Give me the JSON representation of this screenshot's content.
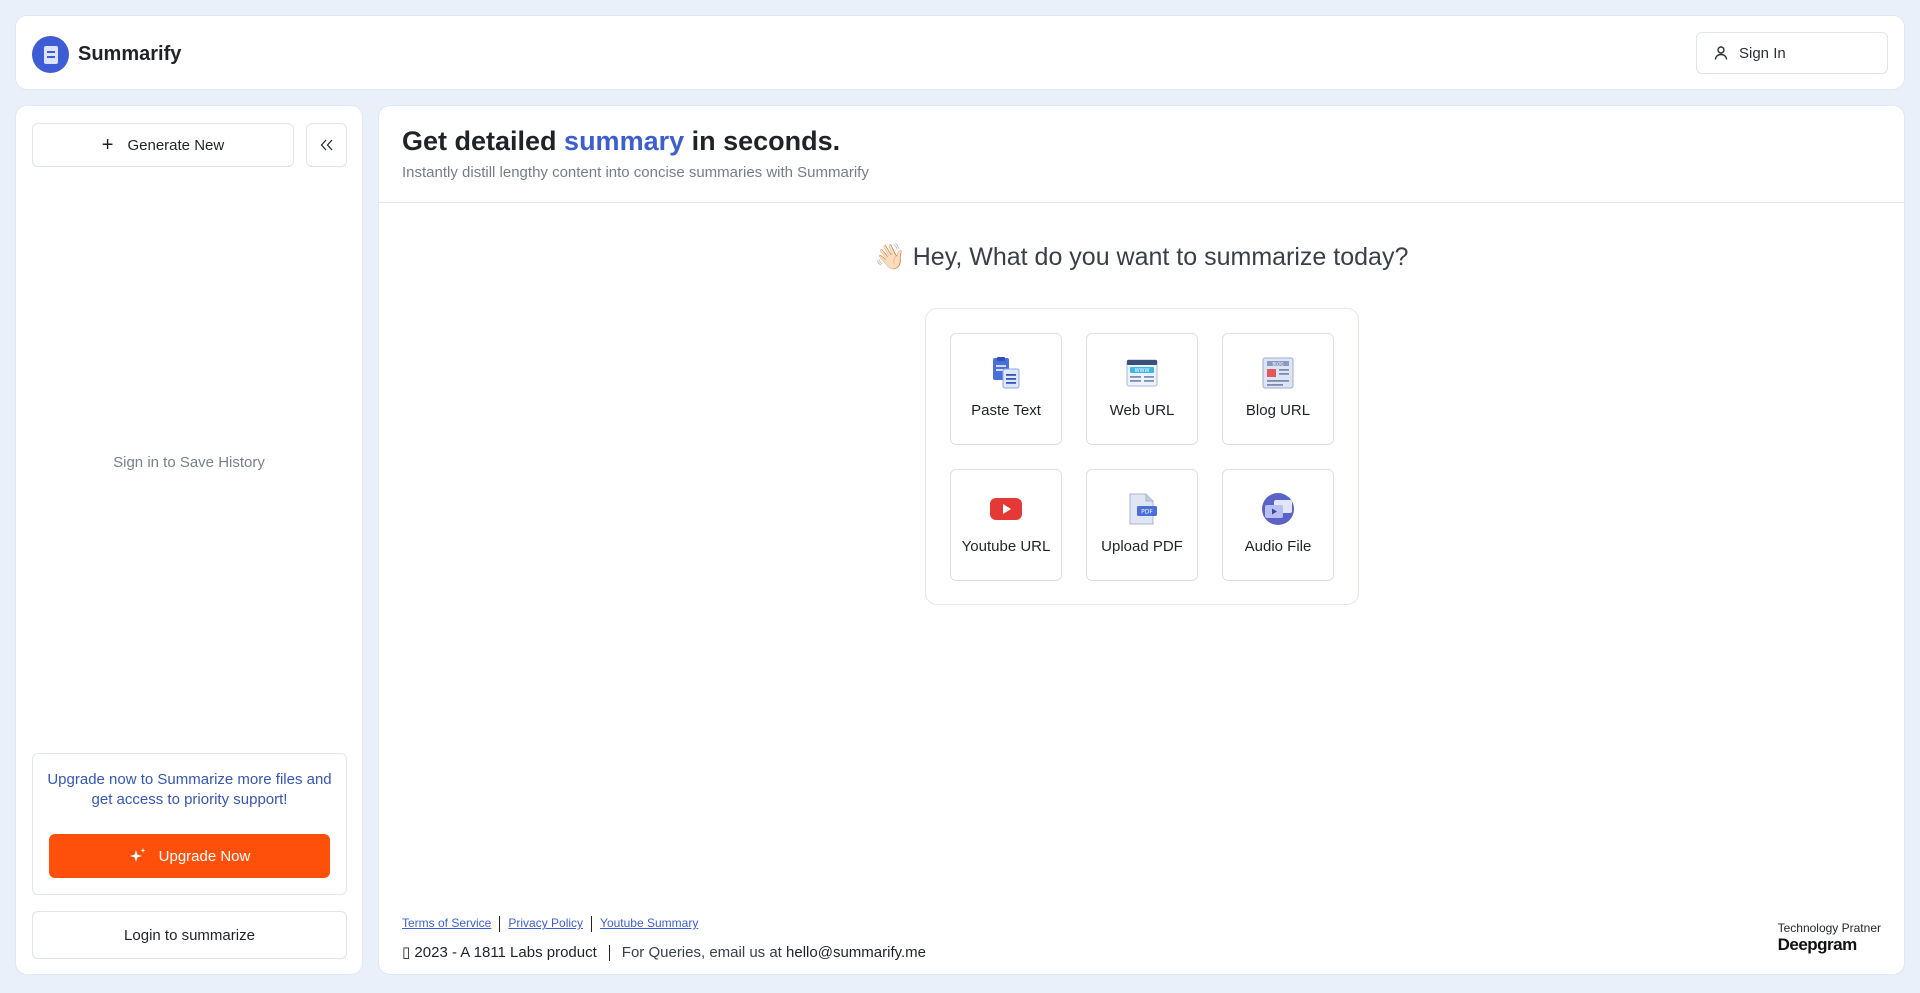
{
  "app": {
    "name": "Summarify"
  },
  "header": {
    "signin_label": "Sign In"
  },
  "sidebar": {
    "generate_label": "Generate New",
    "history_message": "Sign in to Save History",
    "upgrade_text": "Upgrade now to Summarize more files and get access to priority support!",
    "upgrade_label": "Upgrade Now",
    "login_label": "Login to summarize"
  },
  "main": {
    "headline_pre": "Get detailed ",
    "headline_accent": "summary",
    "headline_post": " in seconds.",
    "subline": "Instantly distill lengthy content into concise summaries with Summarify",
    "greeting_emoji": "👋🏻",
    "greeting": "Hey, What do you want to summarize today?",
    "options": [
      {
        "label": "Paste Text",
        "icon": "paste-text-icon"
      },
      {
        "label": "Web URL",
        "icon": "web-url-icon"
      },
      {
        "label": "Blog URL",
        "icon": "blog-url-icon"
      },
      {
        "label": "Youtube URL",
        "icon": "youtube-icon"
      },
      {
        "label": "Upload PDF",
        "icon": "pdf-icon"
      },
      {
        "label": "Audio File",
        "icon": "audio-file-icon"
      }
    ]
  },
  "footer": {
    "links": [
      "Terms of Service",
      "Privacy Policy",
      "Youtube Summary"
    ],
    "copyright": "▯ 2023 - A 1811 Labs product",
    "queries_text": "For Queries, email us at ",
    "email": "hello@summarify.me",
    "partner_label": "Technology Pratner",
    "partner_name": "Deepgram"
  },
  "colors": {
    "accent": "#3d5ed1",
    "upgrade_button": "#fe4f0b",
    "background": "#eaf0fa"
  }
}
